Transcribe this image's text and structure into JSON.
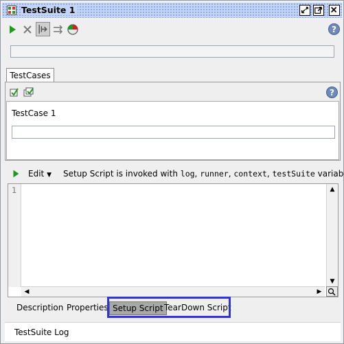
{
  "window": {
    "title": "TestSuite 1"
  },
  "toolbar": {
    "icons": [
      "run-icon",
      "cancel-icon",
      "toggle-icon",
      "arrows-icon",
      "load-icon"
    ]
  },
  "tabs": {
    "testcases_tab": "TestCases"
  },
  "testcases": {
    "items": [
      "TestCase 1"
    ]
  },
  "script": {
    "edit_label": "Edit",
    "desc_prefix": "Setup Script is invoked with ",
    "vars": [
      "log",
      "runner",
      "context",
      "testSuite"
    ],
    "desc_suffix": " variables",
    "line_numbers": [
      "1"
    ]
  },
  "bottom_tabs": [
    "Description",
    "Properties",
    "Setup Script",
    "TearDown Script"
  ],
  "log": {
    "label": "TestSuite Log"
  },
  "colors": {
    "highlight": "#2f36c9",
    "title_bg": "#c3d4f5"
  }
}
